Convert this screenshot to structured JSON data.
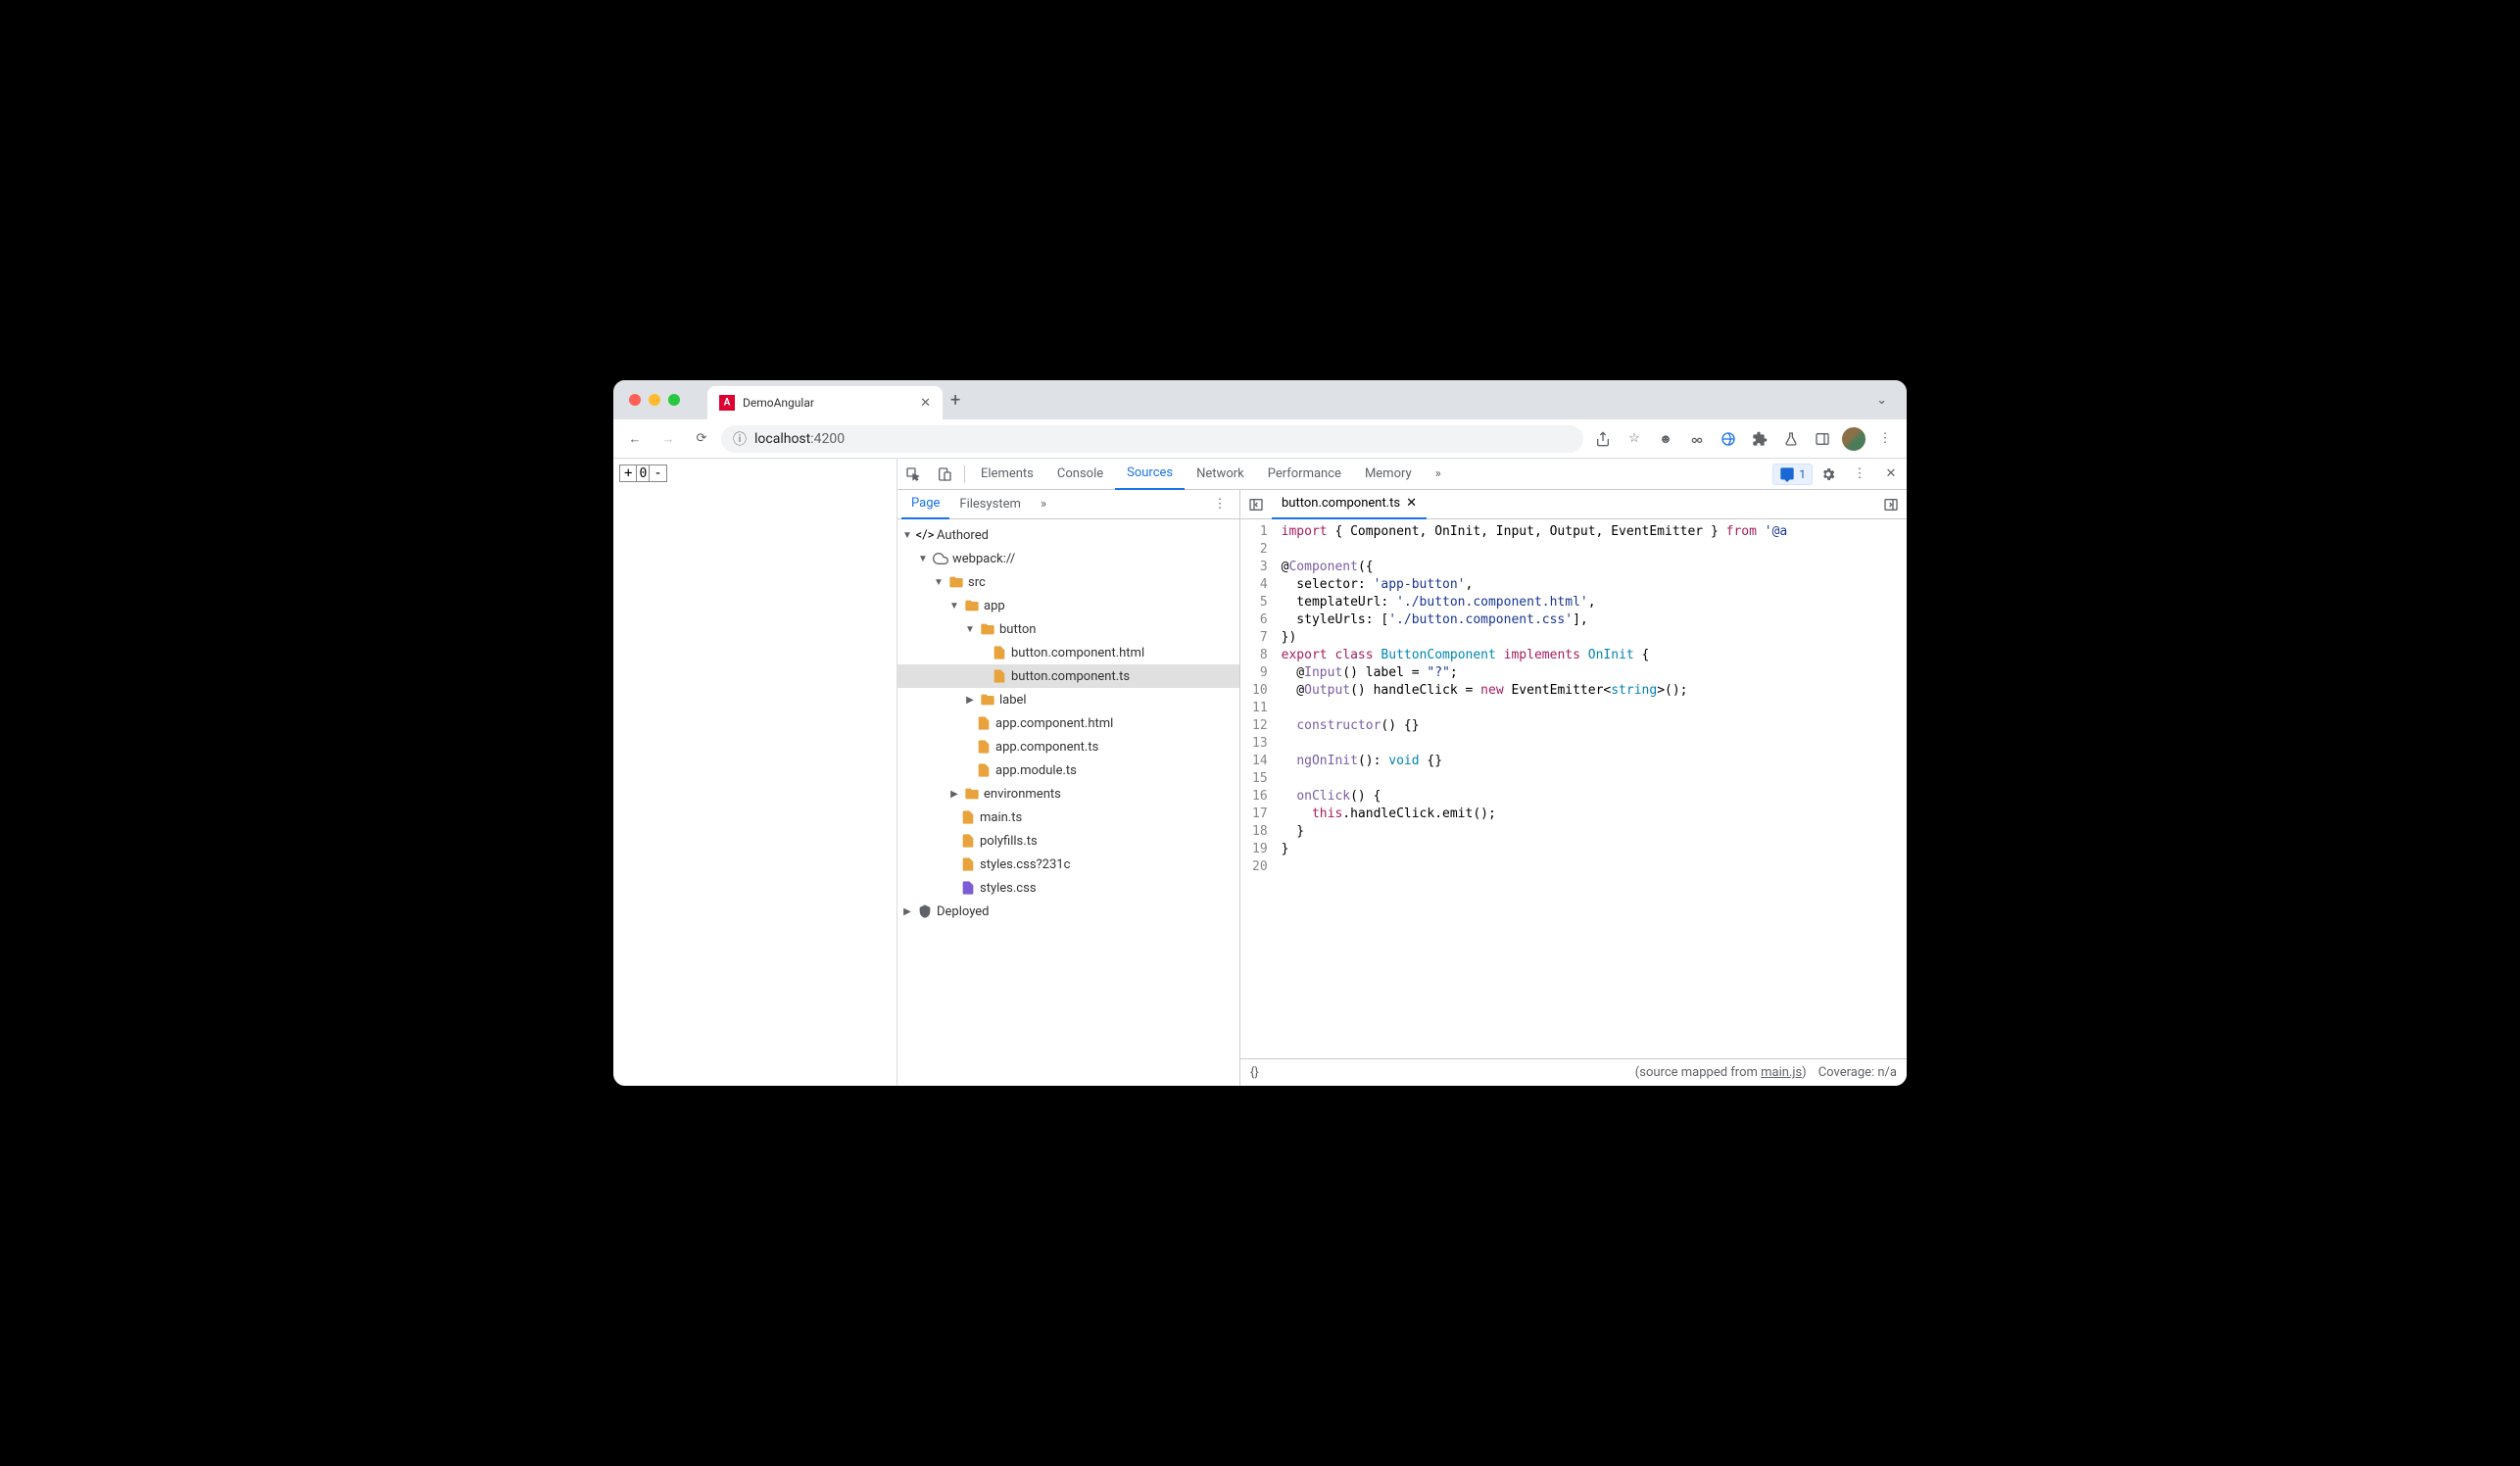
{
  "browser": {
    "tab_title": "DemoAngular",
    "url_host": "localhost",
    "url_port": ":4200",
    "counter_value": "0",
    "counter_plus": "+",
    "counter_minus": "-"
  },
  "devtools": {
    "tabs": [
      "Elements",
      "Console",
      "Sources",
      "Network",
      "Performance",
      "Memory"
    ],
    "active_tab": "Sources",
    "more": "»",
    "issue_count": "1",
    "sub_tabs": [
      "Page",
      "Filesystem"
    ],
    "sub_more": "»"
  },
  "tree": {
    "root": "Authored",
    "webpack": "webpack://",
    "src": "src",
    "app": "app",
    "button": "button",
    "button_html": "button.component.html",
    "button_ts": "button.component.ts",
    "label": "label",
    "app_html": "app.component.html",
    "app_ts": "app.component.ts",
    "app_module": "app.module.ts",
    "env": "environments",
    "main": "main.ts",
    "polyfills": "polyfills.ts",
    "styles_q": "styles.css?231c",
    "styles": "styles.css",
    "deployed": "Deployed"
  },
  "editor": {
    "filename": "button.component.ts",
    "lines": 20,
    "code_tokens": [
      [
        [
          "kw",
          "import"
        ],
        [
          "",
          " { Component, OnInit, Input, Output, EventEmitter } "
        ],
        [
          "kw",
          "from"
        ],
        [
          "",
          " "
        ],
        [
          "str",
          "'@a"
        ]
      ],
      [],
      [
        [
          "",
          "@"
        ],
        [
          "fn",
          "Component"
        ],
        [
          "",
          "({"
        ]
      ],
      [
        [
          "",
          "  selector: "
        ],
        [
          "str",
          "'app-button'"
        ],
        [
          "",
          ","
        ]
      ],
      [
        [
          "",
          "  templateUrl: "
        ],
        [
          "str",
          "'./button.component.html'"
        ],
        [
          "",
          ","
        ]
      ],
      [
        [
          "",
          "  styleUrls: ["
        ],
        [
          "str",
          "'./button.component.css'"
        ],
        [
          "",
          "],"
        ]
      ],
      [
        [
          "",
          "})"
        ]
      ],
      [
        [
          "kw",
          "export"
        ],
        [
          "",
          " "
        ],
        [
          "kw",
          "class"
        ],
        [
          "",
          " "
        ],
        [
          "cls",
          "ButtonComponent"
        ],
        [
          "",
          " "
        ],
        [
          "kw",
          "implements"
        ],
        [
          "",
          " "
        ],
        [
          "cls",
          "OnInit"
        ],
        [
          "",
          " {"
        ]
      ],
      [
        [
          "",
          "  @"
        ],
        [
          "fn",
          "Input"
        ],
        [
          "",
          "() label = "
        ],
        [
          "str",
          "\"?\""
        ],
        [
          "",
          ";"
        ]
      ],
      [
        [
          "",
          "  @"
        ],
        [
          "fn",
          "Output"
        ],
        [
          "",
          "() handleClick = "
        ],
        [
          "kw",
          "new"
        ],
        [
          "",
          " EventEmitter<"
        ],
        [
          "type",
          "string"
        ],
        [
          "",
          ">();"
        ]
      ],
      [],
      [
        [
          "",
          "  "
        ],
        [
          "fn",
          "constructor"
        ],
        [
          "",
          "() {}"
        ]
      ],
      [],
      [
        [
          "",
          "  "
        ],
        [
          "fn",
          "ngOnInit"
        ],
        [
          "",
          "(): "
        ],
        [
          "type",
          "void"
        ],
        [
          "",
          " {}"
        ]
      ],
      [],
      [
        [
          "",
          "  "
        ],
        [
          "fn",
          "onClick"
        ],
        [
          "",
          "() {"
        ]
      ],
      [
        [
          "",
          "    "
        ],
        [
          "kw",
          "this"
        ],
        [
          "",
          ".handleClick.emit();"
        ]
      ],
      [
        [
          "",
          "  }"
        ]
      ],
      [
        [
          "",
          "}"
        ]
      ],
      []
    ]
  },
  "status": {
    "braces": "{}",
    "mapped_prefix": "(source mapped from ",
    "mapped_file": "main.js",
    "mapped_suffix": ")",
    "coverage": "Coverage: n/a"
  }
}
